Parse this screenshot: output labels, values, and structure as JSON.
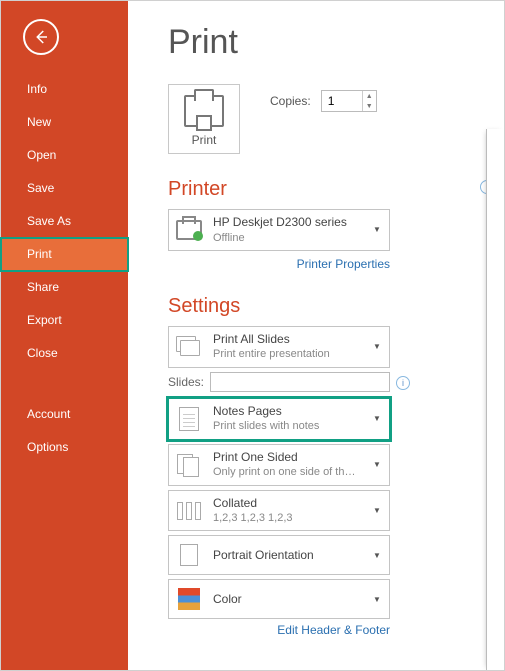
{
  "sidebar": {
    "items": [
      {
        "label": "Info"
      },
      {
        "label": "New"
      },
      {
        "label": "Open"
      },
      {
        "label": "Save"
      },
      {
        "label": "Save As"
      },
      {
        "label": "Print"
      },
      {
        "label": "Share"
      },
      {
        "label": "Export"
      },
      {
        "label": "Close"
      }
    ],
    "bottom": [
      {
        "label": "Account"
      },
      {
        "label": "Options"
      }
    ]
  },
  "page": {
    "title": "Print"
  },
  "print_button": {
    "label": "Print"
  },
  "copies": {
    "label": "Copies:",
    "value": "1"
  },
  "sections": {
    "printer_heading": "Printer",
    "settings_heading": "Settings"
  },
  "printer": {
    "name": "HP Deskjet D2300 series",
    "status": "Offline",
    "properties_link": "Printer Properties"
  },
  "settings": {
    "what": {
      "title": "Print All Slides",
      "sub": "Print entire presentation"
    },
    "slides_label": "Slides:",
    "slides_value": "",
    "layout": {
      "title": "Notes Pages",
      "sub": "Print slides with notes"
    },
    "sides": {
      "title": "Print One Sided",
      "sub": "Only print on one side of th…"
    },
    "collate": {
      "title": "Collated",
      "sub": "1,2,3   1,2,3   1,2,3"
    },
    "orientation": {
      "title": "Portrait Orientation",
      "sub": ""
    },
    "color": {
      "title": "Color",
      "sub": ""
    }
  },
  "footer_link": "Edit Header & Footer"
}
